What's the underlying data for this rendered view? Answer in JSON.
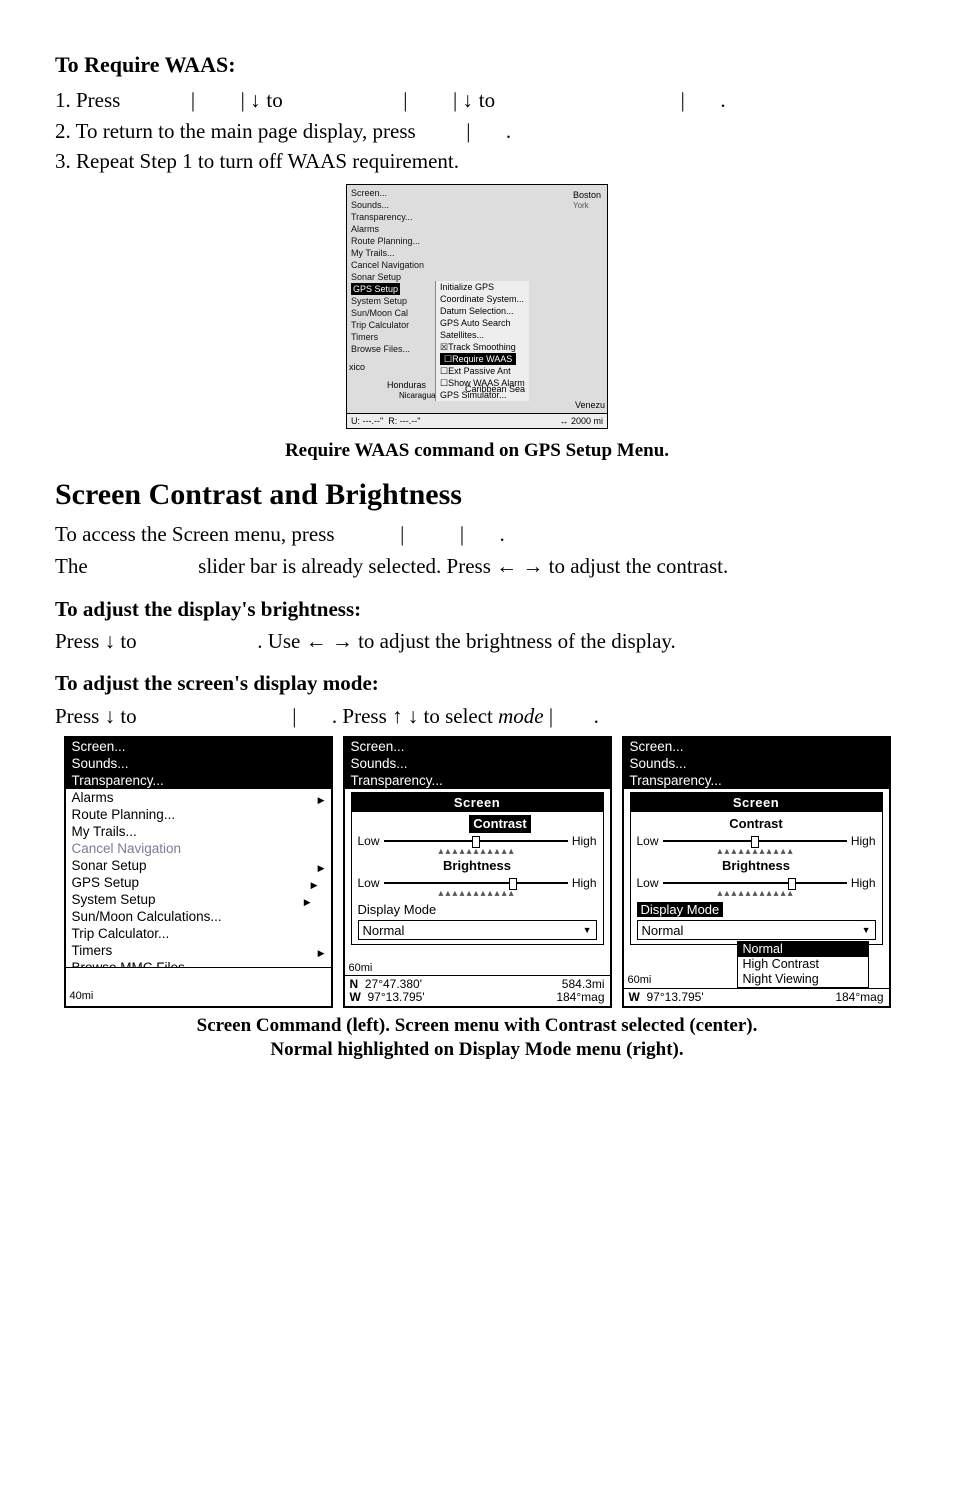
{
  "waas": {
    "heading": "To Require WAAS:",
    "step1_a": "1. Press",
    "step1_b": "to",
    "step1_c": "to",
    "step2": "2. To return to the main page display, press",
    "step3": "3. Repeat Step 1 to turn off WAAS requirement."
  },
  "fig1": {
    "menu": [
      "Screen...",
      "Sounds...",
      "Transparency...",
      "Alarms",
      "Route Planning...",
      "My Trails...",
      "Cancel Navigation",
      "Sonar Setup"
    ],
    "gps_setup": "GPS Setup",
    "menu2": [
      "System Setup",
      "Sun/Moon Cal",
      "Trip Calculator",
      "Timers",
      "Browse Files..."
    ],
    "sub": [
      "Initialize GPS",
      "Coordinate System...",
      "Datum Selection...",
      "GPS Auto Search",
      "Satellites...",
      "Track Smoothing"
    ],
    "require": "Require WAAS",
    "sub2": [
      "Ext Passive Ant",
      "Show WAAS Alarm",
      "GPS Simulator..."
    ],
    "map": {
      "xico": "xico",
      "honduras": "Honduras",
      "nicaragua": "Nicaragua",
      "carib": "Caribbean Sea",
      "venez": "Venezu",
      "boston": "Boston",
      "york": "York"
    },
    "status_u": "U: ---.--\"",
    "status_r": "R: ---.--\"",
    "status_scale": "↔ 2000 mi",
    "caption": "Require WAAS command on GPS Setup Menu."
  },
  "section": {
    "heading": "Screen Contrast and Brightness",
    "p1": "To access the Screen menu, press",
    "p2_a": "The",
    "p2_b": "slider bar is already selected. Press ← → to adjust the contrast.",
    "h_bright": "To adjust the display's brightness:",
    "p3_a": "Press ↓ to",
    "p3_b": ". Use ← → to adjust the brightness of the display.",
    "h_mode": "To adjust the screen's display mode",
    "colon": ":",
    "p4_a": "Press ↓ to",
    "p4_b": ". Press ↑ ↓ to select ",
    "p4_mode": "mode"
  },
  "panels": {
    "left": {
      "items_top": [
        "Screen...",
        "Sounds...",
        "Transparency..."
      ],
      "items_mid": [
        "Alarms",
        "Route Planning...",
        "My Trails..."
      ],
      "dim": "Cancel Navigation",
      "items_bot": [
        "Sonar Setup",
        "GPS Setup",
        "System Setup",
        "Sun/Moon Calculations...",
        "Trip Calculator...",
        "Timers",
        "Browse MMC Files..."
      ],
      "scale": "40mi"
    },
    "center": {
      "items": [
        "Screen...",
        "Sounds...",
        "Transparency..."
      ],
      "popup_title": "Screen",
      "contrast": "Contrast",
      "brightness": "Brightness",
      "low": "Low",
      "high": "High",
      "dm_label": "Display Mode",
      "dm_value": "Normal",
      "scale": "60mi",
      "coord_n": "27°47.380'",
      "coord_w": "97°13.795'",
      "dist": "584.3mi",
      "brg": "184°mag"
    },
    "right": {
      "items": [
        "Screen...",
        "Sounds...",
        "Transparency..."
      ],
      "popup_title": "Screen",
      "contrast": "Contrast",
      "brightness": "Brightness",
      "low": "Low",
      "high": "High",
      "dm_label": "Display Mode",
      "dm_value": "Normal",
      "dm_options": [
        "Normal",
        "High Contrast",
        "Night Viewing"
      ],
      "coord_w": "97°13.795'",
      "brg": "184°mag",
      "scale": "60mi"
    }
  },
  "caption2_l1": "Screen Command (left). Screen menu with Contrast selected (center).",
  "caption2_l2": "Normal highlighted on Display Mode menu (right).",
  "bar": "|",
  "dot": "."
}
